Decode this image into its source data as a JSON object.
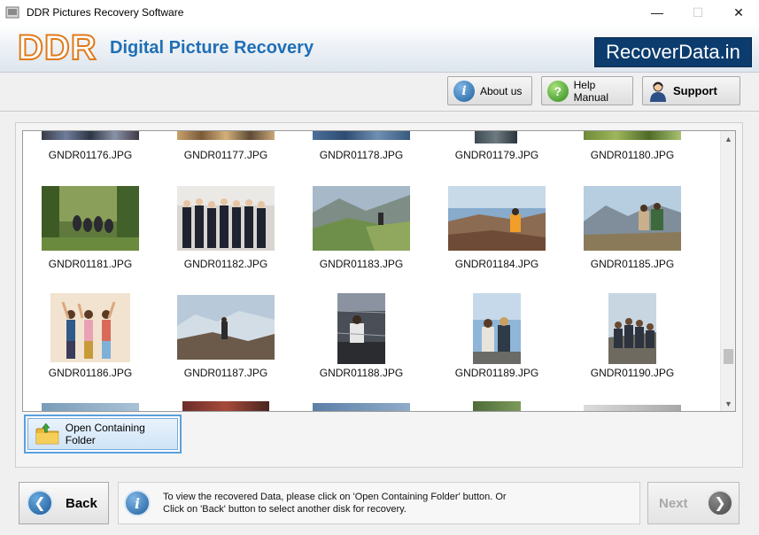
{
  "window": {
    "title": "DDR Pictures Recovery Software",
    "controls": [
      "—",
      "☐",
      "✕"
    ]
  },
  "banner": {
    "logo": "DDR",
    "app_name": "Digital Picture Recovery",
    "brand": "RecoverData.in"
  },
  "toolbar": {
    "about": "About us",
    "help": "Help Manual",
    "support": "Support"
  },
  "gallery": {
    "rows": [
      [
        "GNDR01176.JPG",
        "GNDR01177.JPG",
        "GNDR01178.JPG",
        "GNDR01179.JPG",
        "GNDR01180.JPG"
      ],
      [
        "GNDR01181.JPG",
        "GNDR01182.JPG",
        "GNDR01183.JPG",
        "GNDR01184.JPG",
        "GNDR01185.JPG"
      ],
      [
        "GNDR01186.JPG",
        "GNDR01187.JPG",
        "GNDR01188.JPG",
        "GNDR01189.JPG",
        "GNDR01190.JPG"
      ]
    ]
  },
  "open_folder_label": "Open Containing Folder",
  "bottom": {
    "back": "Back",
    "info_line1": "To view the recovered Data, please click on 'Open Containing Folder' button. Or",
    "info_line2": "Click on 'Back' button to select another disk for recovery.",
    "next": "Next"
  }
}
